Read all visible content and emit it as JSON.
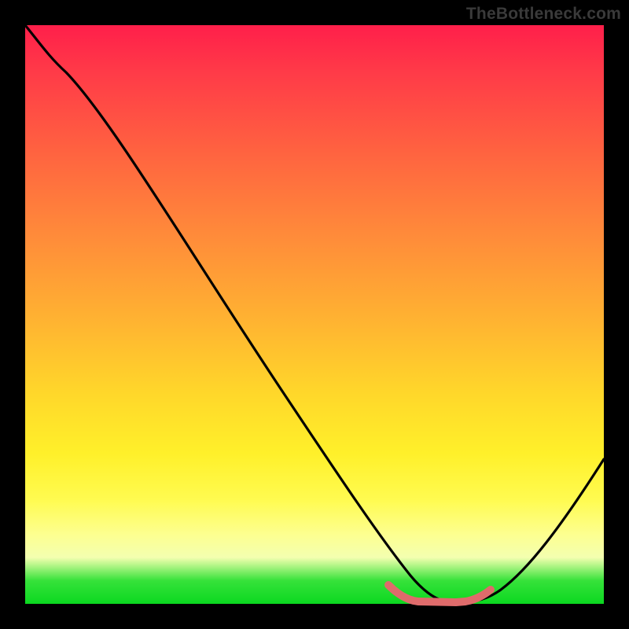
{
  "watermark": "TheBottleneck.com",
  "chart_data": {
    "type": "line",
    "title": "",
    "xlabel": "",
    "ylabel": "",
    "xlim": [
      0,
      100
    ],
    "ylim": [
      0,
      100
    ],
    "series": [
      {
        "name": "bottleneck-curve",
        "color": "#000000",
        "x": [
          0,
          3,
          8,
          15,
          25,
          35,
          45,
          55,
          62,
          66,
          70,
          74,
          78,
          82,
          88,
          94,
          100
        ],
        "values": [
          100,
          98,
          95,
          88,
          75,
          61,
          47,
          33,
          21,
          11,
          4,
          1,
          1,
          3,
          9,
          18,
          31
        ]
      },
      {
        "name": "optimal-range",
        "color": "#e36b6b",
        "x": [
          62,
          66,
          70,
          74,
          78
        ],
        "values": [
          3.2,
          1.6,
          1.0,
          1.2,
          2.6
        ]
      }
    ],
    "background_gradient": {
      "top": "#ff1f4a",
      "upper_mid": "#ff8a3a",
      "mid": "#ffd82a",
      "lower_mid": "#fdff90",
      "bottom": "#0bd820"
    }
  }
}
